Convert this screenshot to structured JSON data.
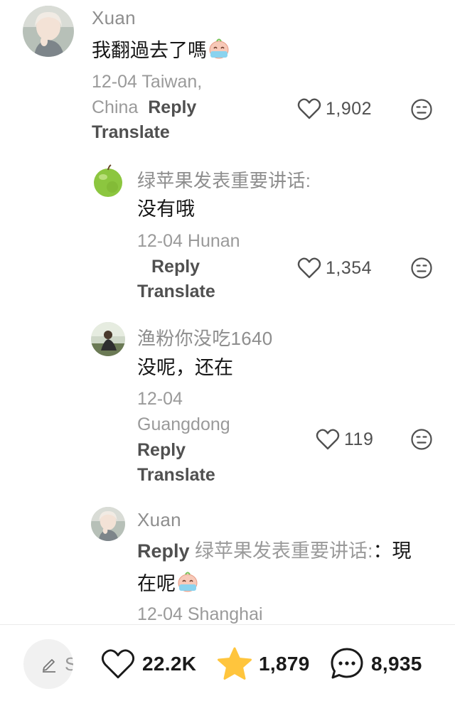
{
  "comments": [
    {
      "username": "Xuan",
      "text": "我翻過去了嗎",
      "emoji": "crying-face-emoji",
      "date": "12-04 Taiwan,",
      "location_line2": "China",
      "reply": "Reply",
      "translate": "Translate",
      "likes": "1,902"
    },
    {
      "username": "绿苹果发表重要讲话:",
      "text": "没有哦",
      "date": "12-04 Hunan",
      "reply": "Reply",
      "translate": "Translate",
      "likes": "1,354"
    },
    {
      "username": "渔粉你没吃1640",
      "text": "没呢，还在",
      "date": "12-04",
      "location_line2": "Guangdong",
      "reply": "Reply",
      "translate": "Translate",
      "likes": "119"
    },
    {
      "username": "Xuan",
      "reply": "Reply",
      "reply_to": "绿苹果发表重要讲话:",
      "text_line1": "：現",
      "text_line2": "在呢",
      "emoji": "crying-face-emoji",
      "date": "12-04 Shanghai"
    }
  ],
  "bottom_bar": {
    "compose_placeholder": "S",
    "likes": "22.2K",
    "favorites": "1,879",
    "comments": "8,935",
    "colors": {
      "star": "#FFC53D",
      "text": "#1a1a1a"
    }
  },
  "icons": [
    "heart-icon",
    "dislike-face-icon",
    "edit-pencil-icon",
    "star-icon",
    "comment-bubble-icon"
  ]
}
